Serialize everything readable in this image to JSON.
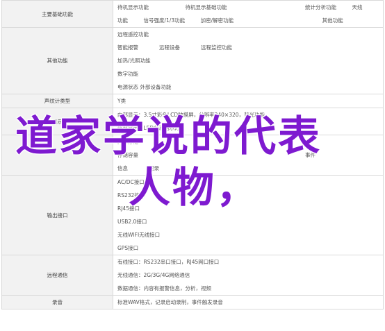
{
  "rows": [
    {
      "cat": "主要基础功能",
      "lines": [
        "待机显示功能　　　　　　　待机显示基础功能　　　　　　　　　　　　　　　统计分析功能　　　天线",
        "功能　　　信号强度/1/3功能　　　加密/解密功能　　　　　　　　　　　　　　　　　其他功能"
      ]
    },
    {
      "cat": "其他功能",
      "lines": [
        "远程遥控功能",
        "智能报警　　　　远程设备　　　　远程监控功能",
        "加热/光照功能",
        "数字功能",
        "电源状态 外部设备功能"
      ]
    },
    {
      "cat": "声纹计类型",
      "lines": [
        "Y类"
      ]
    },
    {
      "cat": "显示",
      "lines": [
        "内部显示：3.5寸彩色LCD触摸屏，分辨率240×320，背光功能",
        "外部显示：LED状态指示灯"
      ]
    },
    {
      "cat": "",
      "lines": [
        "内部存储",
        "存储容量　　　　　　　　　　　　　　　　　　　　　　　　　　　　　　　　事件",
        "信息　　　　记录"
      ]
    },
    {
      "cat": "输出接口",
      "lines": [
        "AC/DC接口",
        "RS232接口",
        "RJ45接口",
        "USB2.0接口",
        "无线WIFI无线接口",
        "GPS接口"
      ]
    },
    {
      "cat": "远程通信",
      "lines": [
        "有线接口：RS232串口接口，RJ45网口接口",
        "无线通信：2G/3G/4G网络通信",
        "数据通信：内容有报警信息，分析，视频"
      ]
    },
    {
      "cat": "录音",
      "lines": [
        "标准WAV格式，记录启动录制，事件触发录音"
      ]
    }
  ],
  "overlay": {
    "line1": "道家学说的代表",
    "line2": "人物，"
  }
}
